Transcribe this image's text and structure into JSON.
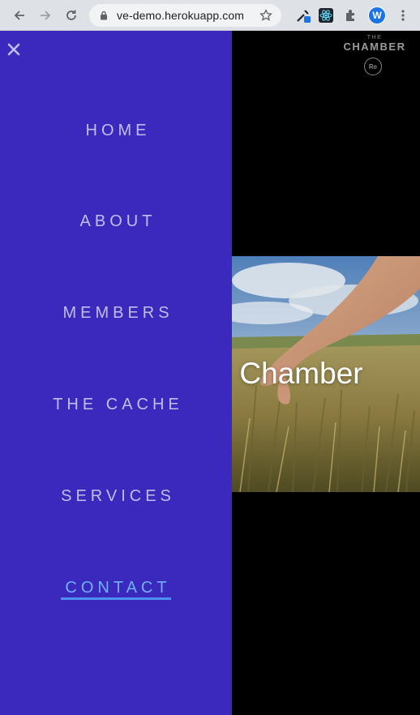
{
  "browser": {
    "url": "ve-demo.herokuapp.com",
    "profile_initial": "W"
  },
  "logo": {
    "the": "THE",
    "name": "CHAMBER",
    "badge": "Re"
  },
  "hero": {
    "title": "he Chamber"
  },
  "nav": {
    "items": [
      {
        "label": "HOME"
      },
      {
        "label": "ABOUT"
      },
      {
        "label": "MEMBERS"
      },
      {
        "label": "THE CACHE"
      },
      {
        "label": "SERVICES"
      },
      {
        "label": "CONTACT"
      }
    ],
    "active": "CONTACT"
  },
  "colors": {
    "drawer": "#3b29bd",
    "nav_text": "#bfbef0",
    "active_link": "#6fb0ff"
  }
}
